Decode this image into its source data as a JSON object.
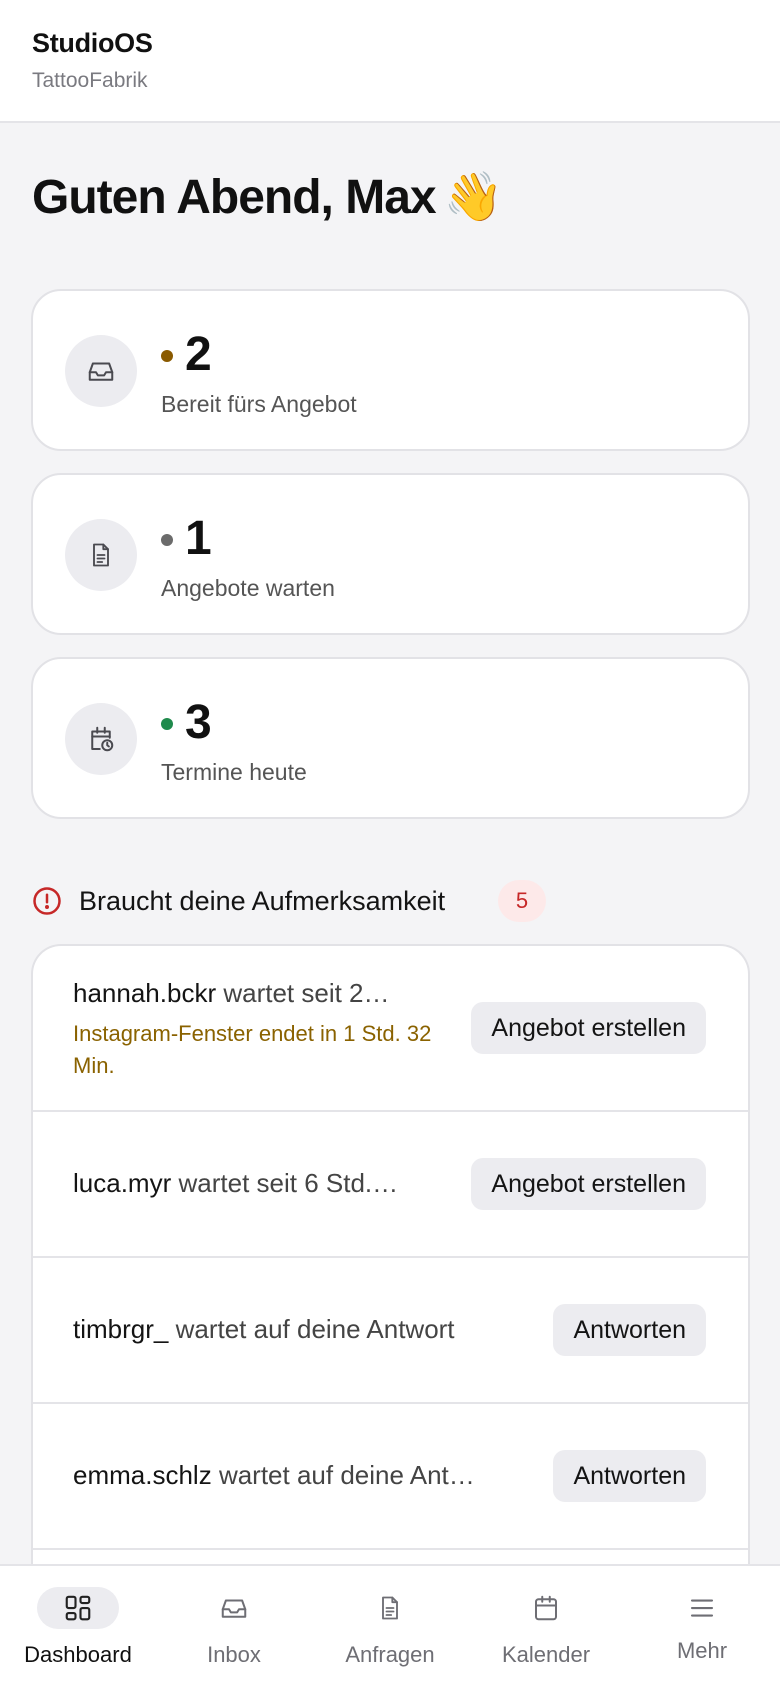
{
  "header": {
    "app_name": "StudioOS",
    "studio_name": "TattooFabrik"
  },
  "greeting": {
    "text": "Guten Abend, Max",
    "emoji": "👋"
  },
  "stats": [
    {
      "value": "2",
      "label": "Bereit fürs Angebot",
      "icon": "inbox-icon",
      "dot_color": "#8a5a00"
    },
    {
      "value": "1",
      "label": "Angebote warten",
      "icon": "document-icon",
      "dot_color": "#6b6b6b"
    },
    {
      "value": "3",
      "label": "Termine heute",
      "icon": "calendar-clock-icon",
      "dot_color": "#1f8a4c"
    }
  ],
  "attention": {
    "title": "Braucht deine Aufmerksamkeit",
    "count": "5",
    "icon": "alert-circle-icon",
    "items": [
      {
        "user": "hannah.bckr",
        "status": "wartet seit 2…",
        "warning": "Instagram-Fenster endet in 1 Std. 32 Min.",
        "action": "Angebot erstellen"
      },
      {
        "user": "luca.myr",
        "status": "wartet seit 6 Std.…",
        "action": "Angebot erstellen"
      },
      {
        "user": "timbrgr_",
        "status": "wartet auf deine Antwort",
        "action": "Antworten"
      },
      {
        "user": "emma.schlz",
        "status": "wartet auf deine Ant…",
        "action": "Antworten"
      }
    ]
  },
  "nav": {
    "active": "Dashboard",
    "items": [
      {
        "label": "Dashboard",
        "icon": "dashboard-grid-icon"
      },
      {
        "label": "Inbox",
        "icon": "inbox-icon"
      },
      {
        "label": "Anfragen",
        "icon": "document-icon"
      },
      {
        "label": "Kalender",
        "icon": "calendar-icon"
      },
      {
        "label": "Mehr",
        "icon": "menu-icon"
      }
    ]
  },
  "colors": {
    "accent_warning": "#8a6200",
    "badge_red": "#c62828",
    "background": "#f4f4f6"
  }
}
